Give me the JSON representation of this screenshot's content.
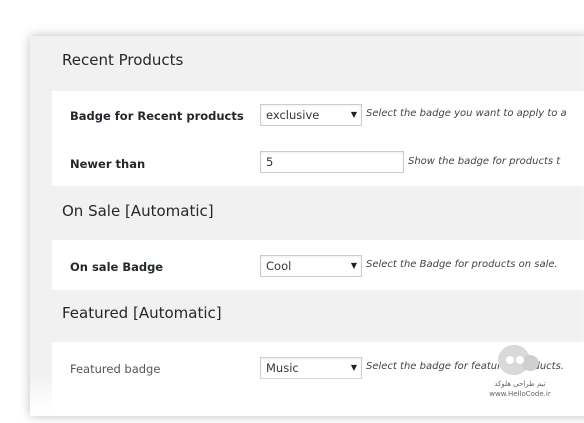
{
  "sections": {
    "recent": {
      "title": "Recent Products",
      "badge_label": "Badge for Recent products",
      "badge_value": "exclusive",
      "badge_desc": "Select the badge you want to apply to a",
      "newer_label": "Newer than",
      "newer_value": "5",
      "newer_desc": "Show the badge for products t"
    },
    "onsale": {
      "title": "On Sale [Automatic]",
      "badge_label": "On sale Badge",
      "badge_value": "Cool",
      "badge_desc": "Select the Badge for products on sale."
    },
    "featured": {
      "title": "Featured [Automatic]",
      "badge_label": "Featured badge",
      "badge_value": "Music",
      "badge_desc": "Select the badge for featured products."
    }
  },
  "watermark": {
    "line1": "تیم طراحی هلوکد",
    "line2": "www.HelloCode.ir"
  },
  "icons": {
    "dropdown": "triangle-down-icon"
  }
}
